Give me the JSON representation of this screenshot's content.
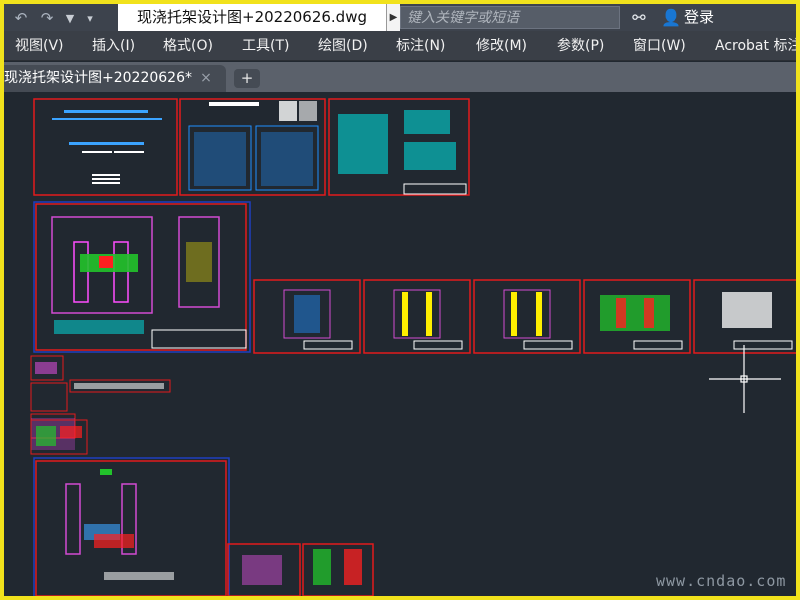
{
  "titlebar": {
    "qa_undo_icon": "undo-arrow-icon",
    "qa_redo_icon": "redo-arrow-icon",
    "qa_dropdown_icon": "dropdown-chevron-icon",
    "document_title": "现浇托架设计图+20220626.dwg",
    "search_placeholder": "键入关键字或短语",
    "login_label": "登录"
  },
  "menu": [
    "视图(V)",
    "插入(I)",
    "格式(O)",
    "工具(T)",
    "绘图(D)",
    "标注(N)",
    "修改(M)",
    "参数(P)",
    "窗口(W)",
    "Acrobat 标注"
  ],
  "tabs": {
    "active_label": "现浇托架设计图+20220626*",
    "close_glyph": "×",
    "new_tab_glyph": "+"
  },
  "canvas": {
    "background": "#212830",
    "sheet_border_color": "#e31a1c",
    "outer_frame_color": "#1f3fbf",
    "watermark": "www.cndao.com"
  }
}
